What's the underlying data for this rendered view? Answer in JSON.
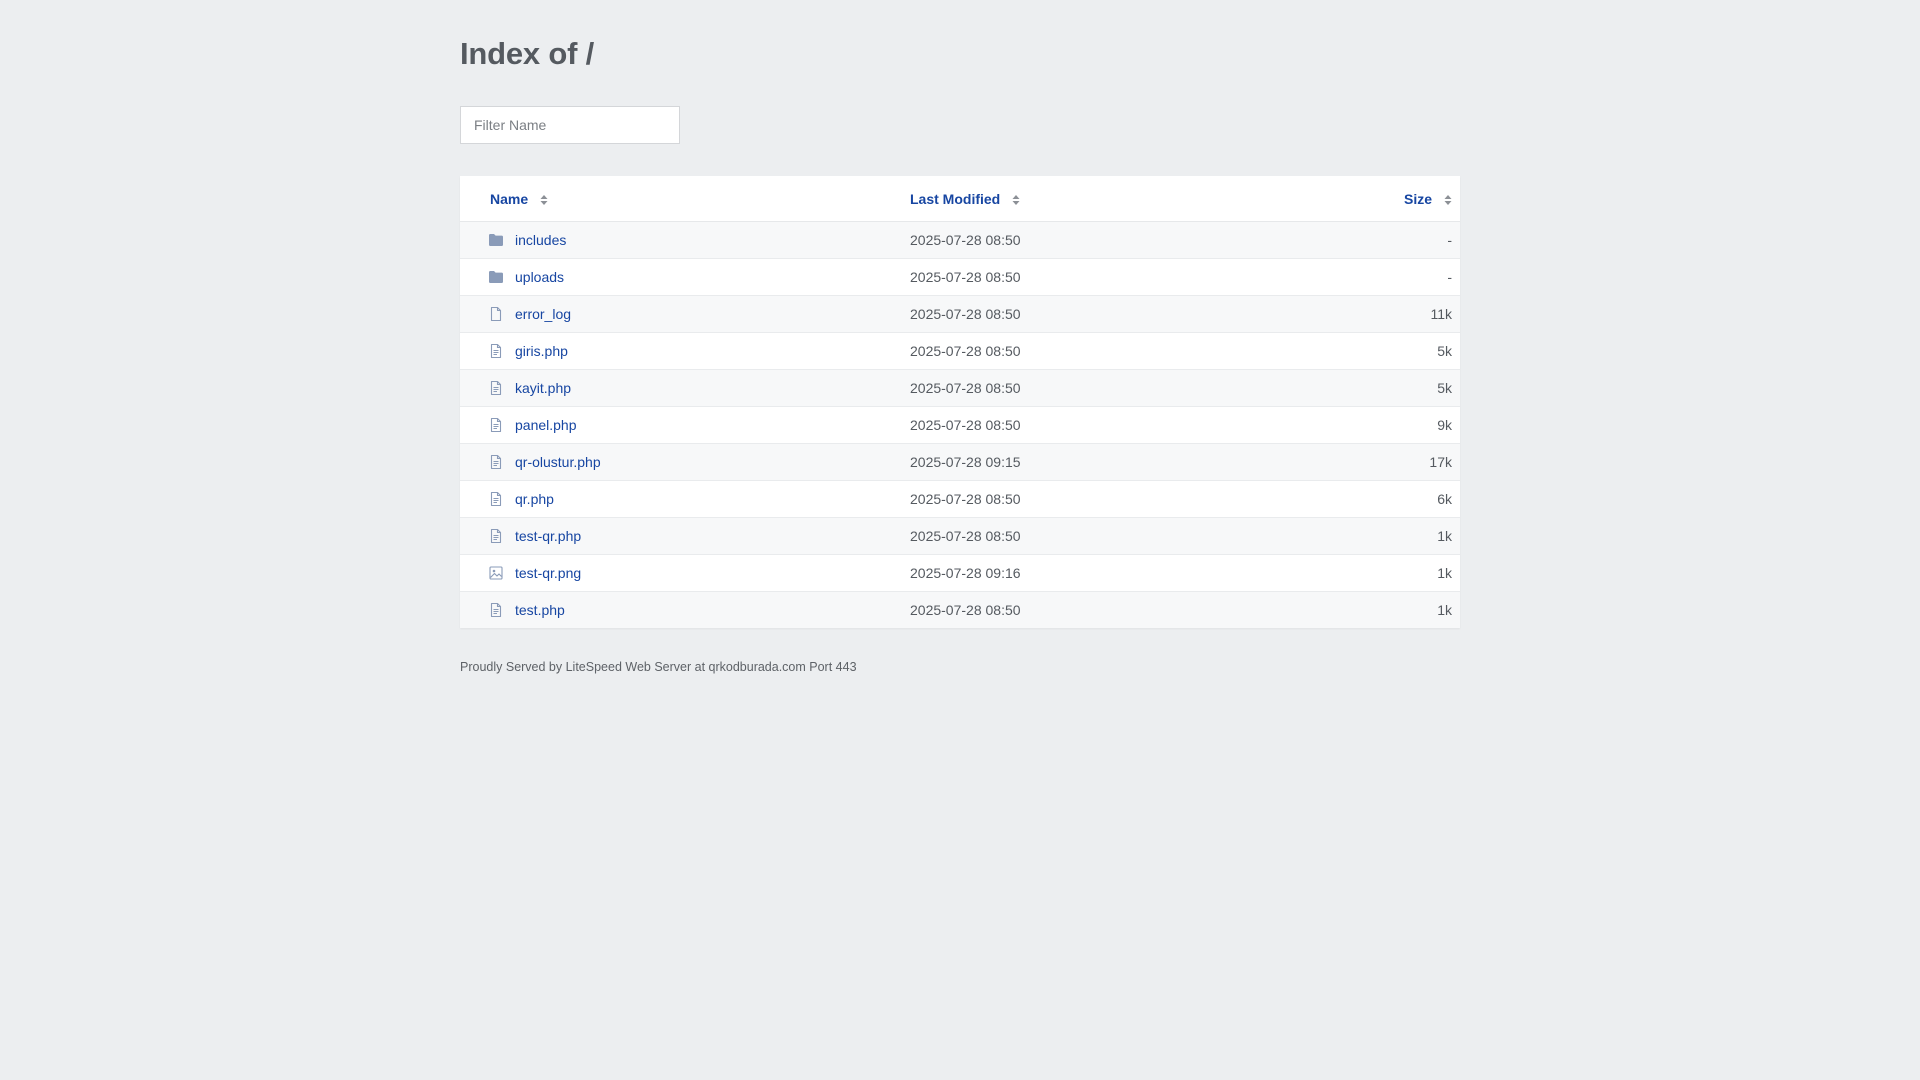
{
  "page": {
    "title": "Index of /",
    "filter_placeholder": "Filter Name"
  },
  "table": {
    "headers": {
      "name": "Name",
      "modified": "Last Modified",
      "size": "Size"
    },
    "rows": [
      {
        "name": "includes",
        "modified": "2025-07-28 08:50",
        "size": "-",
        "icon": "folder-icon"
      },
      {
        "name": "uploads",
        "modified": "2025-07-28 08:50",
        "size": "-",
        "icon": "folder-icon"
      },
      {
        "name": "error_log",
        "modified": "2025-07-28 08:50",
        "size": "11k",
        "icon": "file-icon"
      },
      {
        "name": "giris.php",
        "modified": "2025-07-28 08:50",
        "size": "5k",
        "icon": "text-file-icon"
      },
      {
        "name": "kayit.php",
        "modified": "2025-07-28 08:50",
        "size": "5k",
        "icon": "text-file-icon"
      },
      {
        "name": "panel.php",
        "modified": "2025-07-28 08:50",
        "size": "9k",
        "icon": "text-file-icon"
      },
      {
        "name": "qr-olustur.php",
        "modified": "2025-07-28 09:15",
        "size": "17k",
        "icon": "text-file-icon"
      },
      {
        "name": "qr.php",
        "modified": "2025-07-28 08:50",
        "size": "6k",
        "icon": "text-file-icon"
      },
      {
        "name": "test-qr.php",
        "modified": "2025-07-28 08:50",
        "size": "1k",
        "icon": "text-file-icon"
      },
      {
        "name": "test-qr.png",
        "modified": "2025-07-28 09:16",
        "size": "1k",
        "icon": "image-file-icon"
      },
      {
        "name": "test.php",
        "modified": "2025-07-28 08:50",
        "size": "1k",
        "icon": "text-file-icon"
      }
    ]
  },
  "footer": {
    "text": "Proudly Served by LiteSpeed Web Server at qrkodburada.com Port 443"
  },
  "colors": {
    "link": "#1746a2",
    "background": "#eceef0",
    "folder_icon": "#8a9bb8",
    "file_icon": "#8a9bb8"
  }
}
